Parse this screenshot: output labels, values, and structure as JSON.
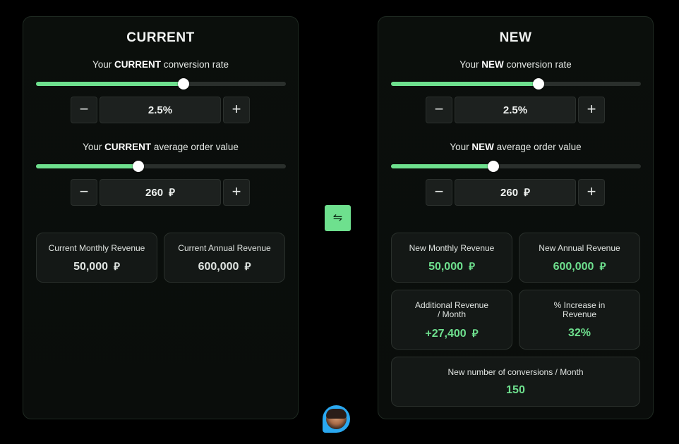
{
  "current": {
    "title": "CURRENT",
    "conversion_label_pre": "Your ",
    "conversion_label_bold": "CURRENT",
    "conversion_label_post": " conversion rate",
    "conversion_slider_value": 0.59,
    "conversion_value": "2.5%",
    "aov_label_pre": "Your ",
    "aov_label_bold": "CURRENT",
    "aov_label_post": " average order value",
    "aov_slider_value": 0.41,
    "aov_value": "260",
    "cards": {
      "monthly": {
        "title": "Current Monthly Revenue",
        "value": "50,000"
      },
      "annual": {
        "title": "Current Annual Revenue",
        "value": "600,000"
      }
    }
  },
  "new": {
    "title": "NEW",
    "conversion_label_pre": "Your ",
    "conversion_label_bold": "NEW",
    "conversion_label_post": " conversion rate",
    "conversion_slider_value": 0.59,
    "conversion_value": "2.5%",
    "aov_label_pre": "Your ",
    "aov_label_bold": "NEW",
    "aov_label_post": " average order value",
    "aov_slider_value": 0.41,
    "aov_value": "260",
    "cards": {
      "monthly": {
        "title": "New Monthly Revenue",
        "value": "50,000"
      },
      "annual": {
        "title": "New Annual Revenue",
        "value": "600,000"
      },
      "additional": {
        "title_line1": "Additional Revenue",
        "title_line2": "/ Month",
        "value": "+27,400"
      },
      "increase": {
        "title_line1": "% Increase in",
        "title_line2": "Revenue",
        "value": "32%"
      },
      "conversions": {
        "title": "New number of conversions / Month",
        "value": "150"
      }
    }
  },
  "controls": {
    "minus_symbol": "−",
    "plus_symbol": "+",
    "swap_symbol": "⇋",
    "currency_symbol": "⃁"
  },
  "colors": {
    "accent": "#6ee08e",
    "background": "#000000",
    "panel": "#0b0f0c",
    "card": "#141816"
  },
  "icons": {
    "swap": "swap-arrows-icon",
    "chat": "chat-avatar-icon"
  }
}
